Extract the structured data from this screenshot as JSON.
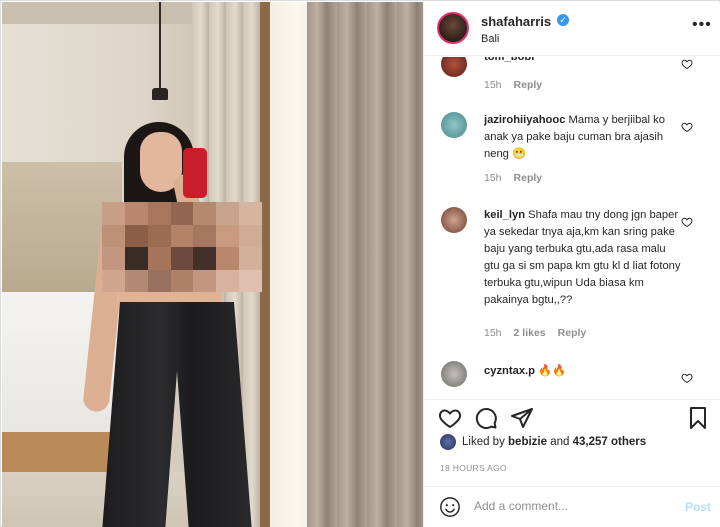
{
  "post": {
    "username": "shafaharris",
    "location": "Bali"
  },
  "comments": [
    {
      "username": "tom_bobr",
      "text": "",
      "time": "15h",
      "likes": "",
      "reply": "Reply"
    },
    {
      "username": "jazirohiiyahooc",
      "text": "Mama y berjiibal ko anak ya pake baju cuman bra ajasih neng 😬",
      "time": "15h",
      "likes": "",
      "reply": "Reply"
    },
    {
      "username": "keil_lyn",
      "text": "Shafa mau tny dong jgn baper ya sekedar tnya aja,km kan sring pake baju yang terbuka gtu,ada rasa malu gtu ga si sm papa km gtu kl d liat fotony terbuka gtu,wipun Uda biasa km pakainya bgtu,,??",
      "time": "15h",
      "likes": "2 likes",
      "reply": "Reply"
    },
    {
      "username": "cyzntax.p",
      "text": "🔥🔥",
      "time": "",
      "likes": "",
      "reply": ""
    }
  ],
  "likes": {
    "prefix": "Liked by ",
    "user": "bebizie",
    "middle": " and ",
    "count": "43,257 others"
  },
  "timestamp": "18 HOURS AGO",
  "composer": {
    "placeholder": "Add a comment...",
    "post_label": "Post"
  },
  "icons": {
    "more": "more-options-icon",
    "heart": "heart-icon",
    "comment": "comment-icon",
    "share": "share-icon",
    "save": "bookmark-icon",
    "emoji": "emoji-icon",
    "verified": "verified-badge-icon"
  },
  "colors": {
    "link_blue": "#3897f0",
    "post_disabled": "#b2dffc",
    "meta_gray": "#8e8e8e"
  }
}
